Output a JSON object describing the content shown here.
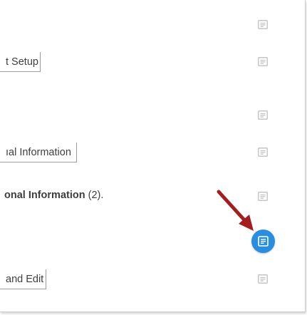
{
  "rows": {
    "setup_label": "t Setup",
    "info_label": "ıal Information",
    "instruction_bold": "onal Information",
    "instruction_rest": " (2).",
    "edit_label": "and Edit"
  },
  "colors": {
    "accent_button": "#2a8ee0",
    "annotation_arrow": "#a31f1f",
    "icon_gray": "#c4c4c4"
  },
  "icons": {
    "row_icon": "note-icon",
    "active_icon": "note-icon",
    "annotation": "arrow-icon"
  }
}
